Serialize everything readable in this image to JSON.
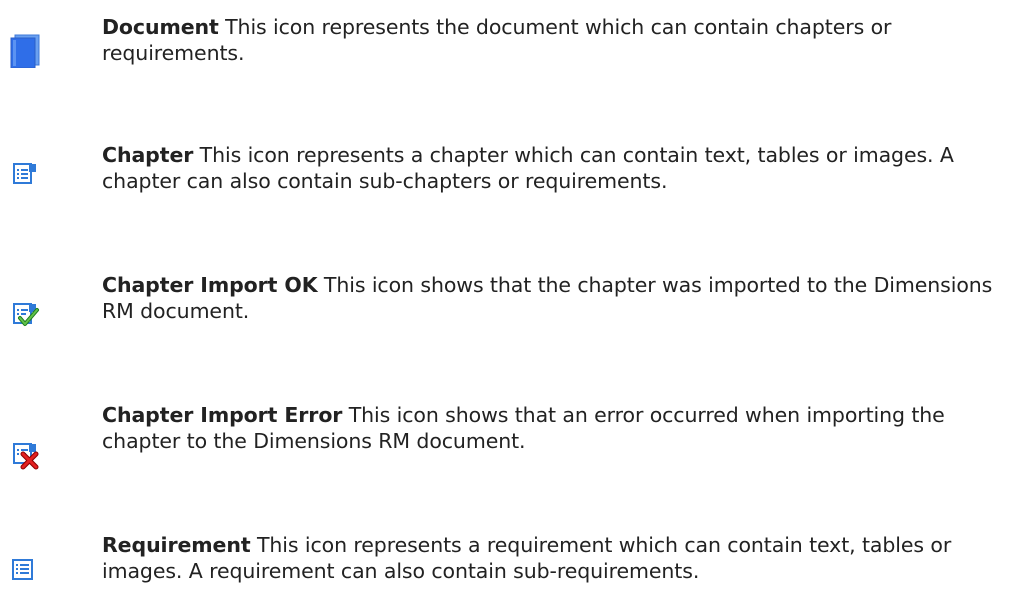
{
  "items": [
    {
      "icon": "document-icon",
      "term": "Document",
      "description": " This icon represents the document which can contain chapters or requirements."
    },
    {
      "icon": "chapter-icon",
      "term": "Chapter",
      "description": " This icon represents a chapter which can contain text, tables or images. A chapter can also contain sub-chapters or requirements."
    },
    {
      "icon": "chapter-import-ok-icon",
      "term": "Chapter Import OK",
      "description": " This icon shows that the chapter was imported to the Dimensions RM document."
    },
    {
      "icon": "chapter-import-error-icon",
      "term": "Chapter Import Error",
      "description": " This icon shows that an error occurred when importing the chapter to the Dimensions RM document."
    },
    {
      "icon": "requirement-icon",
      "term": "Requirement",
      "description": " This icon represents a requirement which can contain text, tables or images. A requirement can also contain sub-requirements."
    }
  ]
}
